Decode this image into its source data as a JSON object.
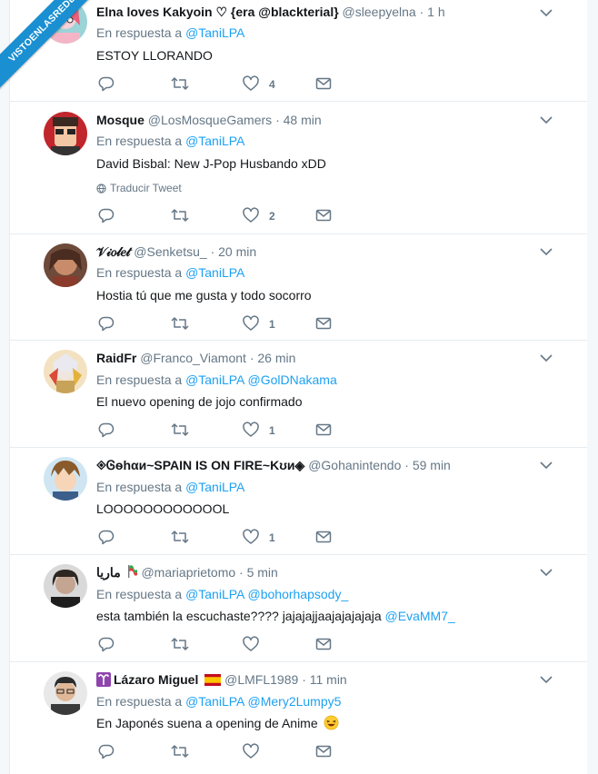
{
  "watermark": "VISTOENLASREDES",
  "colors": {
    "mention": "#1da1f2",
    "muted": "#657786",
    "text": "#14171a"
  },
  "tweets": [
    {
      "name": "Elna loves Kakyoin ♡ {era @blackterial}",
      "handle": "@sleepyelna",
      "time": "· 1 h",
      "reply_prefix": "En respuesta a",
      "reply_mentions": "@TaniLPA",
      "text": "ESTOY LLORANDO",
      "likes": "4"
    },
    {
      "name": "Mosque",
      "handle": "@LosMosqueGamers",
      "time": "· 48 min",
      "reply_prefix": "En respuesta a",
      "reply_mentions": "@TaniLPA",
      "text": "David Bisbal: New J-Pop Husbando xDD",
      "translate": "Traducir Tweet",
      "likes": "2"
    },
    {
      "name": "𝒱𝒾𝑜𝓁𝑒𝓉",
      "handle": "@Senketsu_",
      "time": "· 20 min",
      "reply_prefix": "En respuesta a",
      "reply_mentions": "@TaniLPA",
      "text": "Hostia tú que me gusta y todo socorro",
      "likes": "1"
    },
    {
      "name": "RaidFr",
      "handle": "@Franco_Viamont",
      "time": "· 26 min",
      "reply_prefix": "En respuesta a",
      "reply_mentions": "@TaniLPA @GolDNakama",
      "text": "El nuevo opening de jojo confirmado",
      "likes": "1"
    },
    {
      "name": "◈Ꮆѳhαи~SPAIN IS ON FIRE~Kʊи◈",
      "handle": "@Gohanintendo",
      "time": "· 59 min",
      "reply_prefix": "En respuesta a",
      "reply_mentions": "@TaniLPA",
      "text": "LOOOOOOOOOOOOL",
      "likes": "1"
    },
    {
      "name": "ماريا",
      "handle": "@mariaprietomo",
      "time": "· 5 min",
      "reply_prefix": "En respuesta a",
      "reply_mentions": "@TaniLPA @bohorhapsody_",
      "text": "esta también la escuchaste???? jajajajjaajajajajaja",
      "text_mention": "@EvaMM7_",
      "likes": ""
    },
    {
      "name": "Lázaro Miguel",
      "handle": "@LMFL1989",
      "time": "· 11 min",
      "reply_prefix": "En respuesta a",
      "reply_mentions": "@TaniLPA @Mery2Lumpy5",
      "text": "En Japonés suena a opening de Anime",
      "likes": ""
    }
  ]
}
